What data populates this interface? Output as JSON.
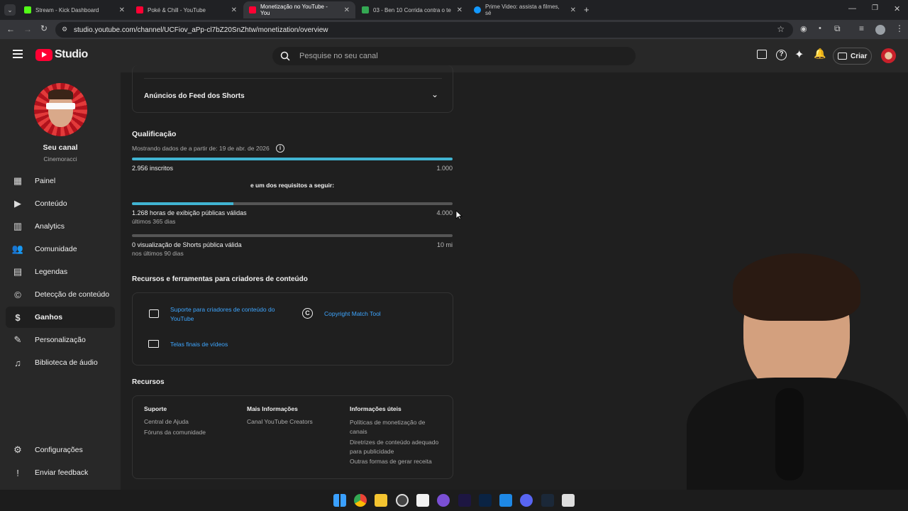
{
  "browser": {
    "tabs": [
      {
        "title": "Stream - Kick Dashboard",
        "color": "#53fc18"
      },
      {
        "title": "Poké & Chill - YouTube",
        "color": "#ff0033"
      },
      {
        "title": "Monetização no YouTube - You",
        "color": "#ff0033"
      },
      {
        "title": "03 - Ben 10 Corrida contra o te",
        "color": "#34a853"
      },
      {
        "title": "Prime Video: assista a filmes, sé",
        "color": "#1399ff"
      }
    ],
    "url": "studio.youtube.com/channel/UCFiov_aPp-cl7bZ20SnZhtw/monetization/overview"
  },
  "header": {
    "logo": "Studio",
    "search_placeholder": "Pesquise no seu canal",
    "create_label": "Criar"
  },
  "sidebar": {
    "channel_title": "Seu canal",
    "channel_name": "Cinemoracci",
    "items": [
      {
        "label": "Painel",
        "icon": "dashboard-icon"
      },
      {
        "label": "Conteúdo",
        "icon": "content-icon"
      },
      {
        "label": "Analytics",
        "icon": "analytics-icon"
      },
      {
        "label": "Comunidade",
        "icon": "community-icon"
      },
      {
        "label": "Legendas",
        "icon": "subtitles-icon"
      },
      {
        "label": "Detecção de conteúdo",
        "icon": "copyright-icon"
      },
      {
        "label": "Ganhos",
        "icon": "earn-icon"
      },
      {
        "label": "Personalização",
        "icon": "customization-icon"
      },
      {
        "label": "Biblioteca de áudio",
        "icon": "audio-library-icon"
      }
    ],
    "settings_label": "Configurações",
    "feedback_label": "Enviar feedback"
  },
  "main": {
    "accordion_label": "Anúncios do Feed dos Shorts",
    "qual": {
      "title": "Qualificação",
      "subtitle": "Mostrando dados de a partir de: 19 de abr. de 2026",
      "subs_label": "2.956 inscritos",
      "subs_target": "1.000",
      "subs_progress": 1.0,
      "or_label": "e um dos requisitos a seguir:",
      "hours_label": "1.268 horas de exibição públicas válidas",
      "hours_period": "últimos 365 dias",
      "hours_target": "4.000",
      "hours_progress": 0.317,
      "shorts_label": "0 visualização de Shorts pública válida",
      "shorts_period": "nos últimos 90 dias",
      "shorts_target": "10 mi",
      "shorts_progress": 0
    },
    "tools": {
      "title": "Recursos e ferramentas para criadores de conteúdo",
      "support_link": "Suporte para criadores de conteúdo do YouTube",
      "copyright_link": "Copyright Match Tool",
      "endscreens_link": "Telas finais de vídeos"
    },
    "resources": {
      "title": "Recursos",
      "col1_title": "Suporte",
      "col1_items": [
        "Central de Ajuda",
        "Fóruns da comunidade"
      ],
      "col2_title": "Mais Informações",
      "col2_items": [
        "Canal YouTube Creators"
      ],
      "col3_title": "Informações úteis",
      "col3_items": [
        "Políticas de monetização de canais",
        "Diretrizes de conteúdo adequado para publicidade",
        "Outras formas de gerar receita"
      ]
    }
  }
}
